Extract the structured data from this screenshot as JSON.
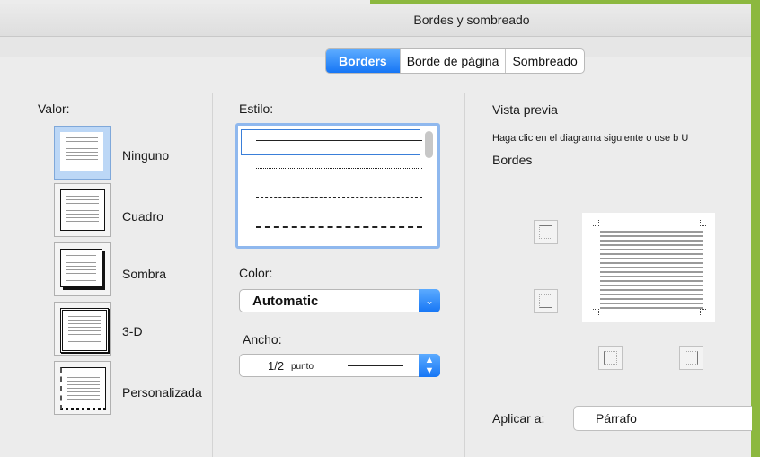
{
  "window": {
    "title": "Bordes y sombreado"
  },
  "tabs": [
    {
      "label": "Borders",
      "active": true
    },
    {
      "label": "Borde de página",
      "active": false
    },
    {
      "label": "Sombreado",
      "active": false
    }
  ],
  "setting": {
    "label": "Valor:",
    "options": [
      {
        "label": "Ninguno",
        "selected": true
      },
      {
        "label": "Cuadro",
        "selected": false
      },
      {
        "label": "Sombra",
        "selected": false
      },
      {
        "label": "3-D",
        "selected": false
      },
      {
        "label": "Personalizada",
        "selected": false
      }
    ]
  },
  "style": {
    "label": "Estilo:",
    "line_styles": [
      "solid",
      "dotted",
      "dashed",
      "long-dashed"
    ],
    "selected": "solid"
  },
  "color": {
    "label": "Color:",
    "value": "Automatic"
  },
  "width": {
    "label": "Ancho:",
    "value": "1/2",
    "unit": "punto"
  },
  "preview": {
    "label": "Vista previa",
    "hint": "Haga clic en el diagrama siguiente o use b U",
    "borders_label": "Bordes"
  },
  "apply_to": {
    "label": "Aplicar a:",
    "value": "Párrafo"
  },
  "colors": {
    "accent": "#1676f5",
    "green": "#8cb83f"
  }
}
